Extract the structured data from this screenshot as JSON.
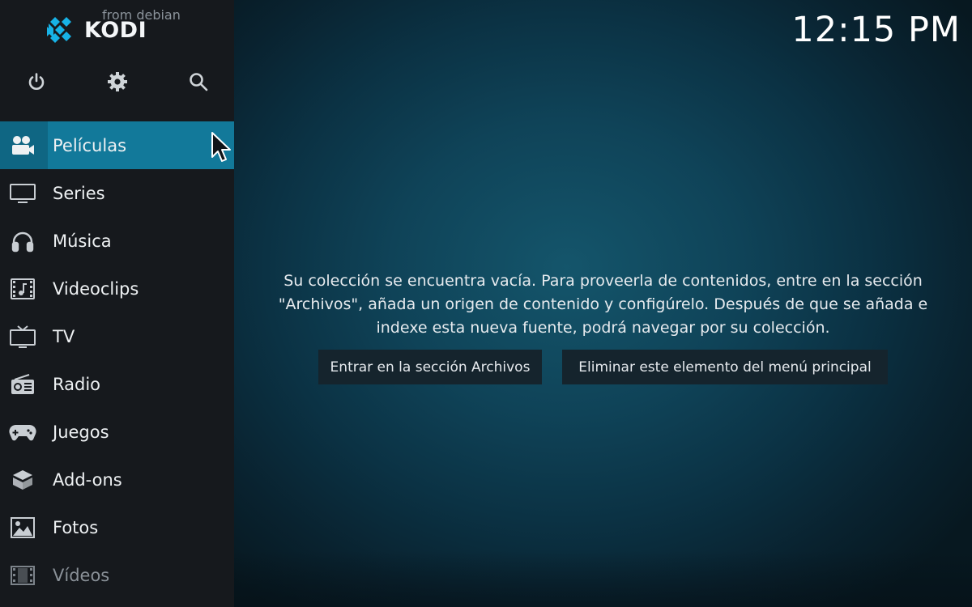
{
  "app": {
    "logo_text": "KODI",
    "logo_subtext": "from debian",
    "clock": "12:15 PM"
  },
  "top_icons": [
    {
      "name": "power-icon"
    },
    {
      "name": "gear-icon"
    },
    {
      "name": "search-icon"
    }
  ],
  "menu": {
    "items": [
      {
        "label": "Películas",
        "icon": "movie-camera-icon",
        "active": true
      },
      {
        "label": "Series",
        "icon": "tv-monitor-icon"
      },
      {
        "label": "Música",
        "icon": "headphones-icon"
      },
      {
        "label": "Videoclips",
        "icon": "music-video-icon"
      },
      {
        "label": "TV",
        "icon": "live-tv-icon"
      },
      {
        "label": "Radio",
        "icon": "radio-icon"
      },
      {
        "label": "Juegos",
        "icon": "gamepad-icon"
      },
      {
        "label": "Add-ons",
        "icon": "addons-box-icon"
      },
      {
        "label": "Fotos",
        "icon": "picture-icon"
      },
      {
        "label": "Vídeos",
        "icon": "film-strip-icon",
        "dim": true
      }
    ]
  },
  "main": {
    "message_lines": [
      "Su colección se encuentra vacía. Para proveerla de contenidos, entre en la sección",
      "\"Archivos\", añada un origen de contenido y configúrelo. Después de que se añada e",
      "indexe esta nueva fuente, podrá navegar por su colección."
    ],
    "button_files": "Entrar en la sección Archivos",
    "button_remove": "Eliminar este elemento del menú principal"
  },
  "colors": {
    "sidebar_bg": "#16191d",
    "active_item": "#12799a",
    "button_bg": "#15242d"
  }
}
